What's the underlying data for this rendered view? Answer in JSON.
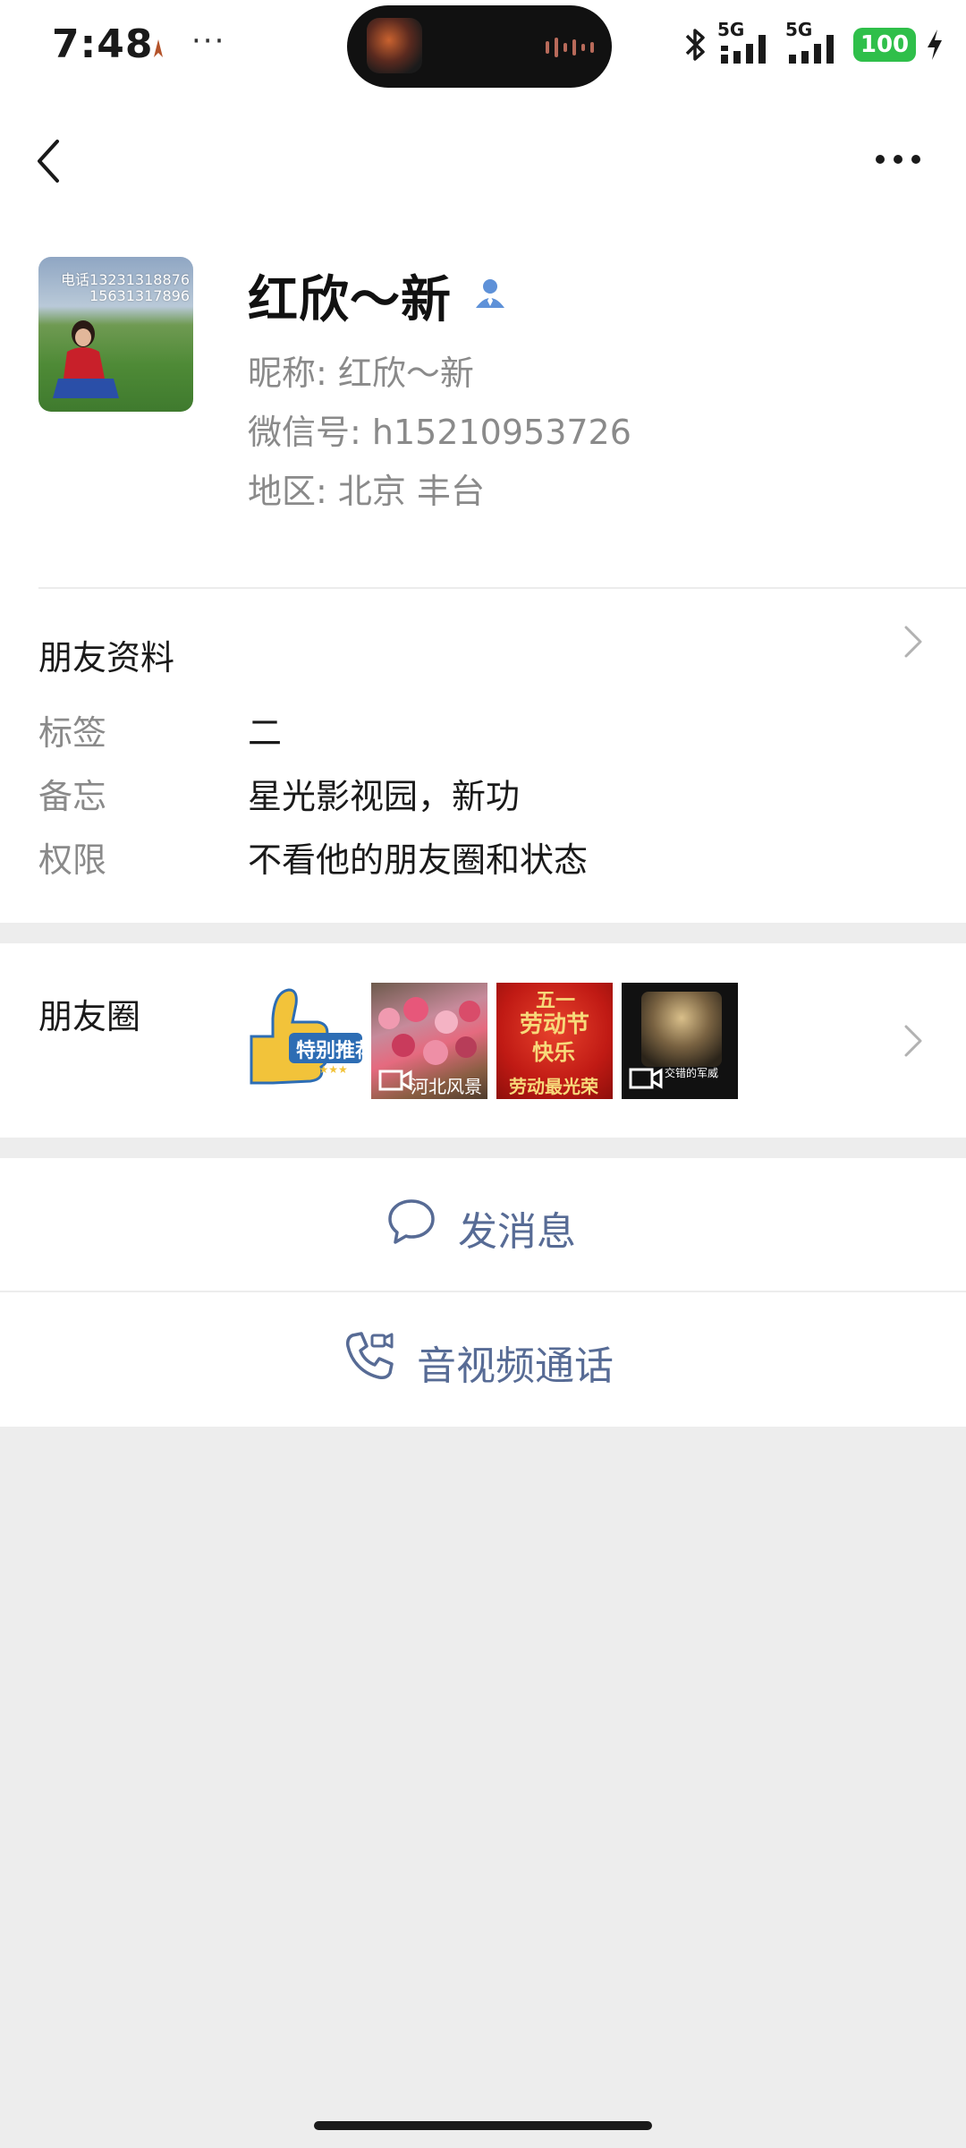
{
  "status_bar": {
    "time": "7:48",
    "dots": "···",
    "network_1": "5G",
    "network_2": "5G",
    "battery": "100"
  },
  "nav": {
    "back_icon": "chevron-left-icon",
    "more_icon": "more-dots-icon"
  },
  "profile": {
    "name": "红欣～新",
    "nickname_line": "昵称:  红欣～新",
    "wechat_id_line": "微信号:  h15210953726",
    "region_line": "地区:  北京  丰台",
    "avatar_text_1": "电话13231318876",
    "avatar_text_2": "15631317896"
  },
  "friend_info": {
    "title": "朋友资料",
    "rows": [
      {
        "label": "标签",
        "value": "二"
      },
      {
        "label": "备忘",
        "value": "星光影视园，新功"
      },
      {
        "label": "权限",
        "value": "不看他的朋友圈和状态"
      }
    ]
  },
  "moments": {
    "title": "朋友圈",
    "thumbs": [
      {
        "caption": "特别推荐",
        "stars": "★★★★★"
      },
      {
        "caption": "河北风景"
      },
      {
        "caption_top": "五一",
        "caption_mid": "劳动节",
        "caption_mid2": "快乐",
        "caption_bottom": "劳动最光荣"
      },
      {
        "caption": "交错的军威"
      }
    ]
  },
  "actions": {
    "send_message": "发消息",
    "av_call": "音视频通话"
  },
  "colors": {
    "link_blue": "#576b95",
    "background": "#ededed",
    "battery_green": "#2fbf4a"
  }
}
